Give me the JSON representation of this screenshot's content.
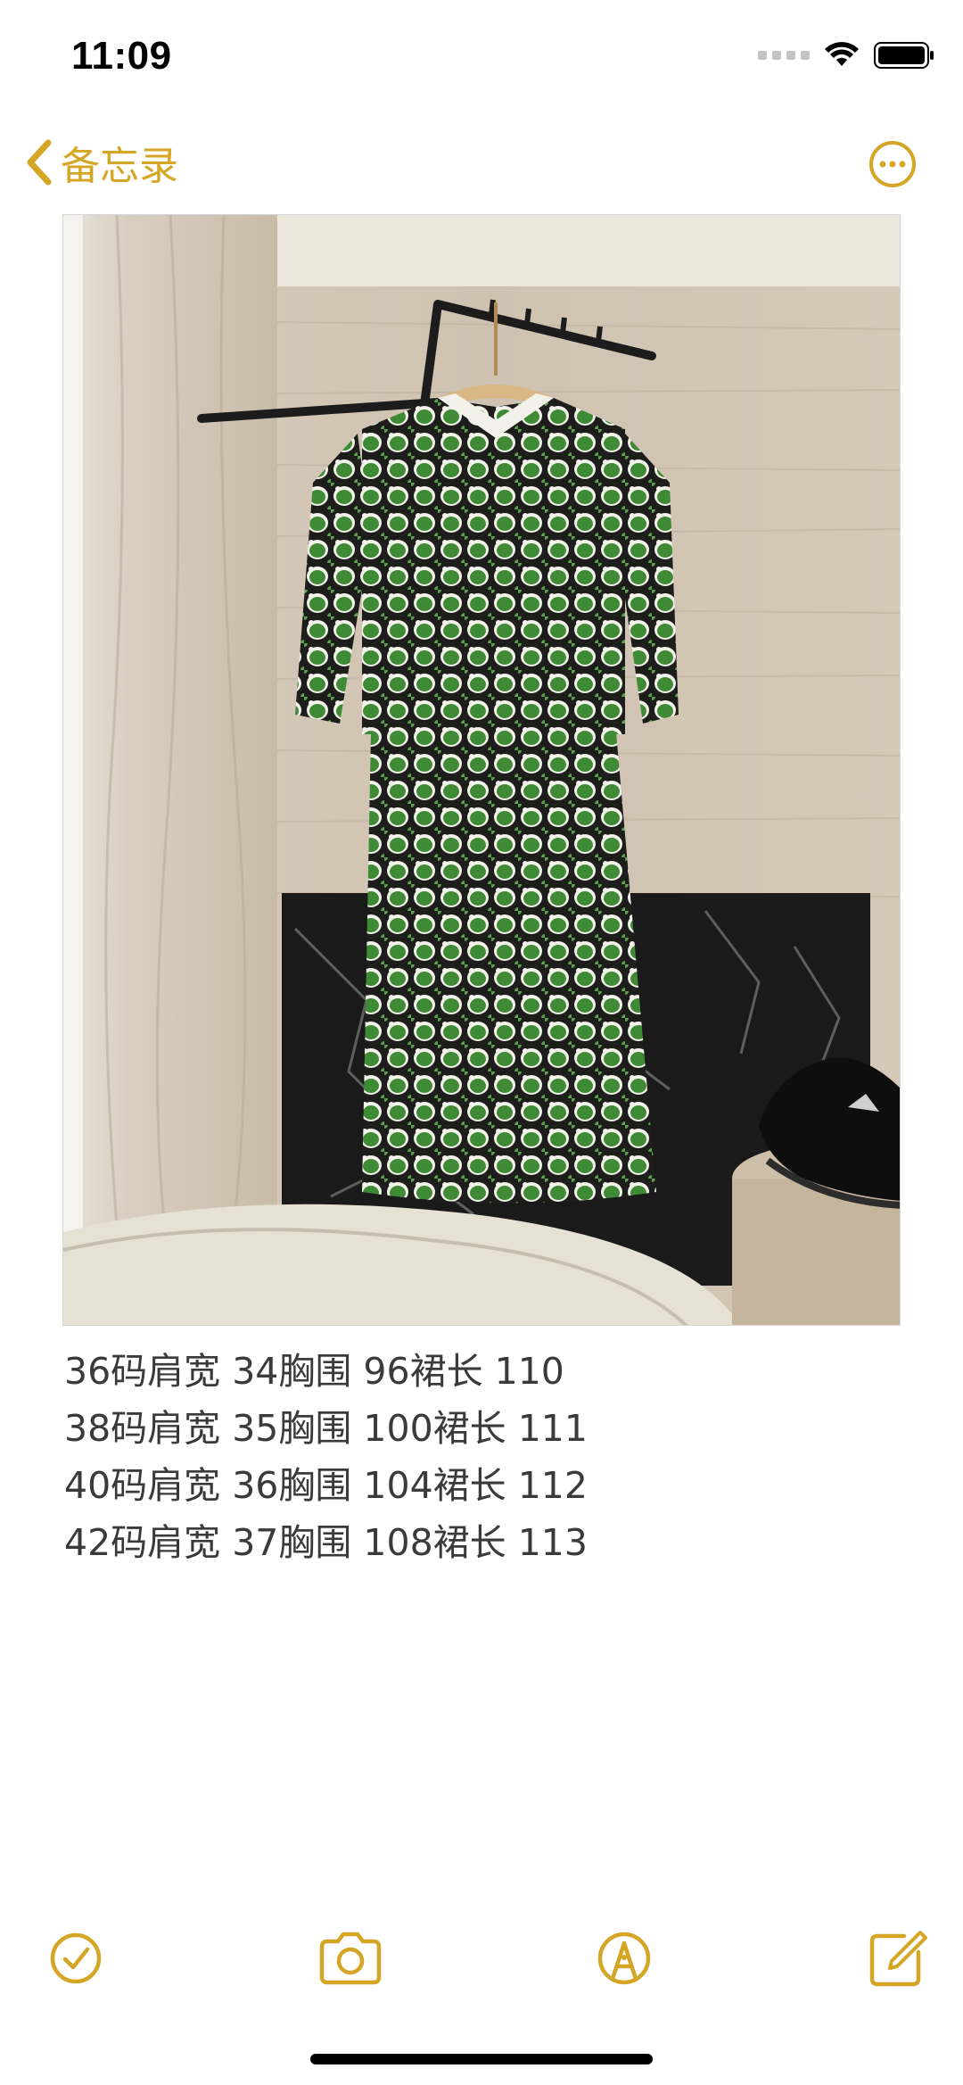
{
  "status_bar": {
    "time": "11:09"
  },
  "nav": {
    "back_label": "备忘录",
    "back_icon": "chevron-left-icon",
    "more_icon": "ellipsis-circle-icon"
  },
  "note": {
    "attachment": "photo-green-patterned-dress",
    "lines": [
      "36码肩宽 34胸围 96裙长 110",
      "38码肩宽 35胸围 100裙长 111",
      "40码肩宽 36胸围 104裙长 112",
      "42码肩宽 37胸围 108裙长 113"
    ]
  },
  "toolbar": {
    "checklist_icon": "checklist-icon",
    "camera_icon": "camera-icon",
    "markup_icon": "markup-pen-icon",
    "compose_icon": "compose-icon"
  },
  "colors": {
    "accent": "#d5a526",
    "text": "#3a3a3c"
  }
}
